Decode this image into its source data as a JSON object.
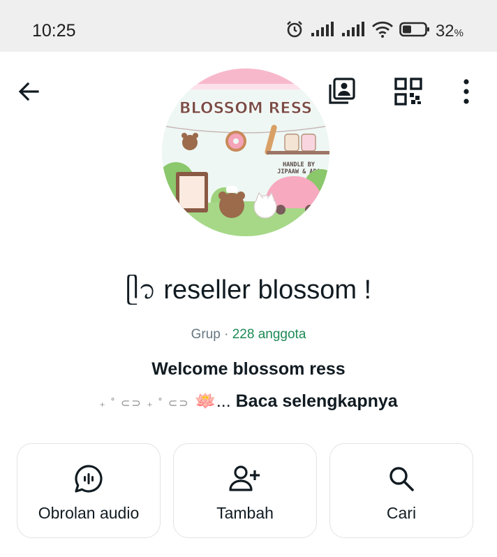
{
  "status_bar": {
    "time": "10:25",
    "battery_percent": "32",
    "battery_unit": "%",
    "icons": [
      "alarm-icon",
      "signal-icon",
      "signal-icon",
      "wifi-icon",
      "battery-icon"
    ]
  },
  "header": {
    "back_icon": "arrow-left-icon",
    "actions": [
      "gallery-icon",
      "qr-code-icon",
      "more-vert-icon"
    ]
  },
  "avatar": {
    "caption_title": "BLOSSOM RESS",
    "caption_handle_1": "HANDLE BY",
    "caption_handle_2": "JIPAAW & ARA"
  },
  "group": {
    "name": "ᥫ᭡ reseller blossom !",
    "type_label": "Grup",
    "separator": " · ",
    "member_count": "228 anggota",
    "description_line1": "Welcome blossom ress",
    "description_deco": "₊ ˚ ⊂⊃ ₊ ˚ ⊂⊃",
    "description_emoji": "🪷",
    "ellipsis": "...",
    "read_more": "Baca selengkapnya"
  },
  "actions": [
    {
      "label": "Obrolan audio",
      "icon": "audio-chat-icon"
    },
    {
      "label": "Tambah",
      "icon": "add-person-icon"
    },
    {
      "label": "Cari",
      "icon": "search-icon"
    }
  ],
  "colors": {
    "accent_green": "#1d8a55",
    "status_bar_bg": "#f0efef"
  }
}
